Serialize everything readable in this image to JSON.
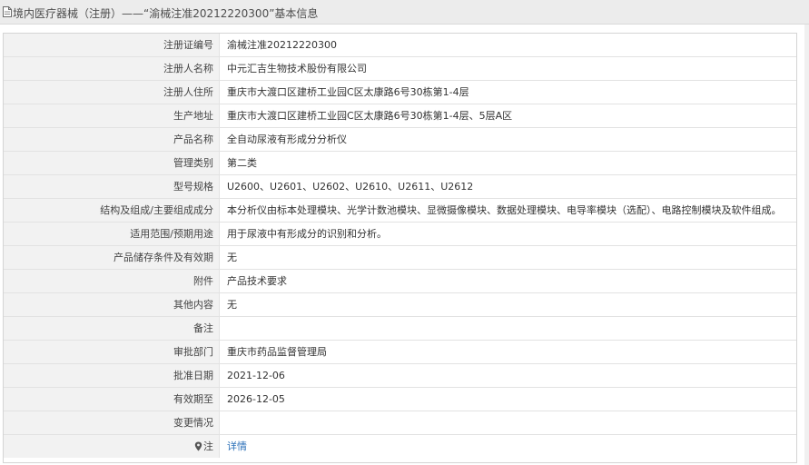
{
  "header": {
    "title": "境内医疗器械（注册）——“渝械注准20212220300”基本信息"
  },
  "details": {
    "registration_no": {
      "label": "注册证编号",
      "value": "渝械注准20212220300"
    },
    "registrant_name": {
      "label": "注册人名称",
      "value": "中元汇吉生物技术股份有限公司"
    },
    "registrant_address": {
      "label": "注册人住所",
      "value": "重庆市大渡口区建桥工业园C区太康路6号30栋第1-4层"
    },
    "production_address": {
      "label": "生产地址",
      "value": "重庆市大渡口区建桥工业园C区太康路6号30栋第1-4层、5层A区"
    },
    "product_name": {
      "label": "产品名称",
      "value": "全自动尿液有形成分分析仪"
    },
    "management_class": {
      "label": "管理类别",
      "value": "第二类"
    },
    "model_spec": {
      "label": "型号规格",
      "value": "U2600、U2601、U2602、U2610、U2611、U2612"
    },
    "structure": {
      "label": "结构及组成/主要组成成分",
      "value": "本分析仪由标本处理模块、光学计数池模块、显微摄像模块、数据处理模块、电导率模块（选配）、电路控制模块及软件组成。"
    },
    "intended_use": {
      "label": "适用范围/预期用途",
      "value": "用于尿液中有形成分的识别和分析。"
    },
    "storage": {
      "label": "产品储存条件及有效期",
      "value": "无"
    },
    "attachment": {
      "label": "附件",
      "value": "产品技术要求"
    },
    "other": {
      "label": "其他内容",
      "value": "无"
    },
    "remarks": {
      "label": "备注",
      "value": ""
    },
    "approval_dept": {
      "label": "审批部门",
      "value": "重庆市药品监督管理局"
    },
    "approval_date": {
      "label": "批准日期",
      "value": "2021-12-06"
    },
    "valid_until": {
      "label": "有效期至",
      "value": "2026-12-05"
    },
    "change_status": {
      "label": "变更情况",
      "value": ""
    },
    "note": {
      "label": "注",
      "link": "详情"
    }
  },
  "colors": {
    "label_bg": "#f2f2f2",
    "link": "#2a6fb8",
    "titlebar_bg": "#ececec"
  }
}
